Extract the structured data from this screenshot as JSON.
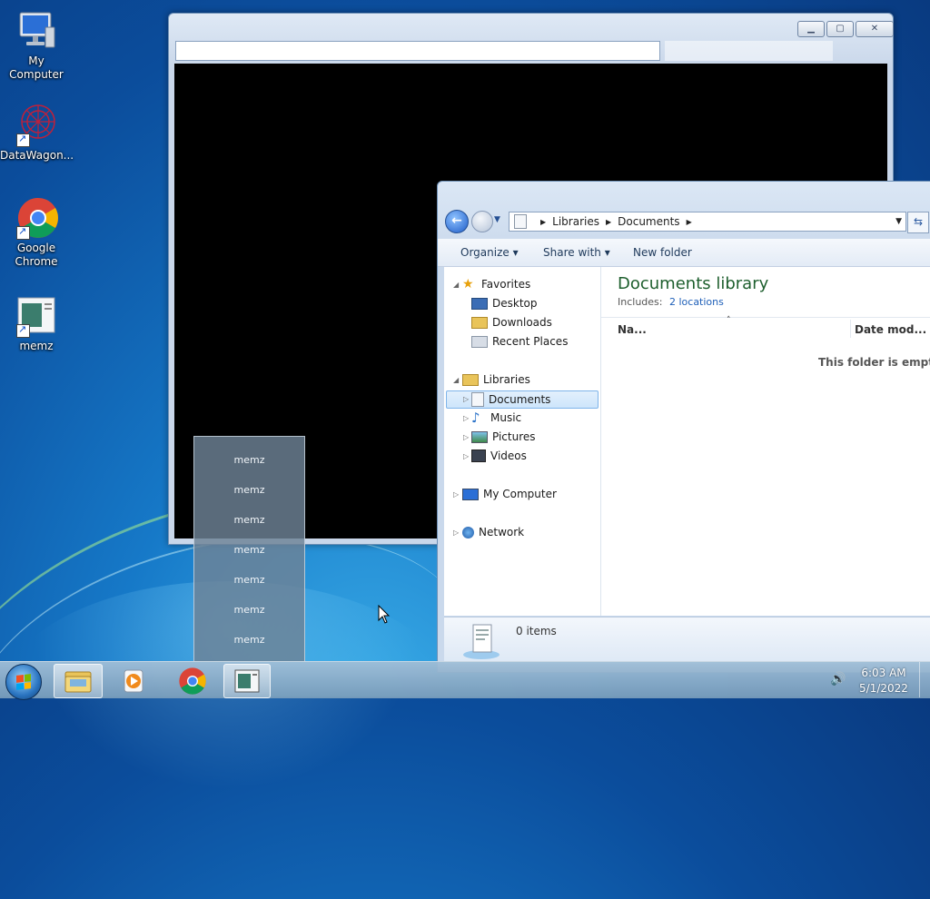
{
  "desktop": {
    "icons": [
      {
        "label": "My Computer"
      },
      {
        "label": "DataWagon..."
      },
      {
        "label": "Google Chrome"
      },
      {
        "label": "memz"
      }
    ]
  },
  "explorer": {
    "breadcrumb": [
      "Libraries",
      "Documents"
    ],
    "toolbar": {
      "organize": "Organize",
      "share_with": "Share with",
      "new_folder": "New folder"
    },
    "nav": {
      "favorites": "Favorites",
      "desktop": "Desktop",
      "downloads": "Downloads",
      "recent_places": "Recent Places",
      "libraries": "Libraries",
      "documents": "Documents",
      "music": "Music",
      "pictures": "Pictures",
      "videos": "Videos",
      "my_computer": "My Computer",
      "network": "Network"
    },
    "library_title": "Documents library",
    "includes_label": "Includes:",
    "includes_link": "2 locations",
    "columns": {
      "name": "Na...",
      "date": "Date mod..."
    },
    "empty_message": "This folder is empty",
    "item_count": "0 items"
  },
  "jumplist": {
    "items": [
      "memz",
      "memz",
      "memz",
      "memz",
      "memz",
      "memz",
      "memz"
    ]
  },
  "taskbar": {
    "time": "6:03 AM",
    "date": "5/1/2022"
  }
}
